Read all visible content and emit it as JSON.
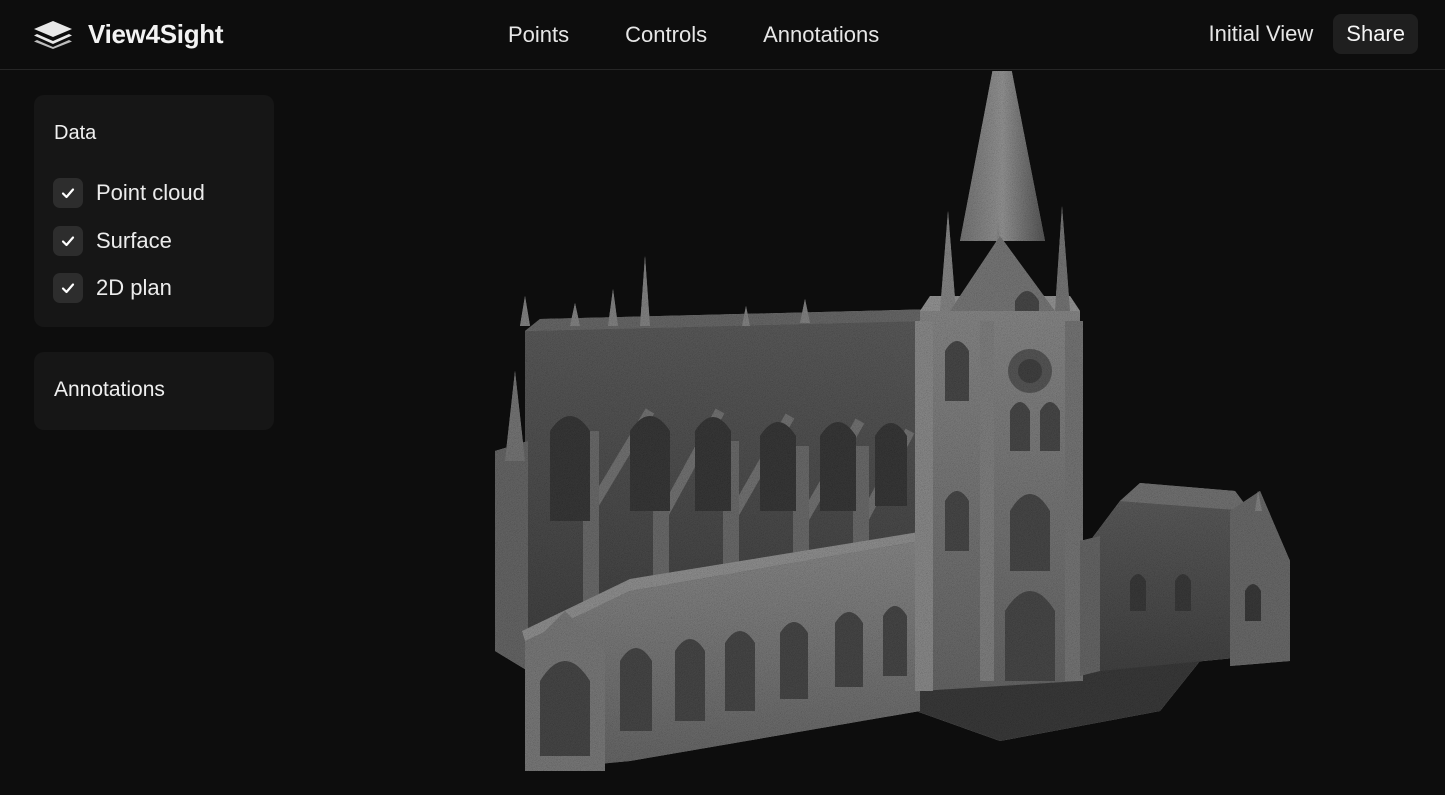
{
  "app": {
    "name": "View4Sight",
    "logo_icon": "layers-icon"
  },
  "nav": {
    "items": [
      {
        "label": "Points"
      },
      {
        "label": "Controls"
      },
      {
        "label": "Annotations"
      }
    ]
  },
  "header_actions": {
    "initial_view_label": "Initial View",
    "share_label": "Share"
  },
  "data_panel": {
    "title": "Data",
    "layers": [
      {
        "label": "Point cloud",
        "checked": true
      },
      {
        "label": "Surface",
        "checked": true
      },
      {
        "label": "2D plan",
        "checked": true
      }
    ]
  },
  "annotations_panel": {
    "title": "Annotations"
  },
  "viewport": {
    "model": "cathedral-point-cloud"
  },
  "colors": {
    "background": "#0d0d0d",
    "panel": "#161616",
    "checkbox": "#2d2d2d",
    "model_light": "#8a8a8a",
    "model_dark": "#4a4a4a"
  }
}
